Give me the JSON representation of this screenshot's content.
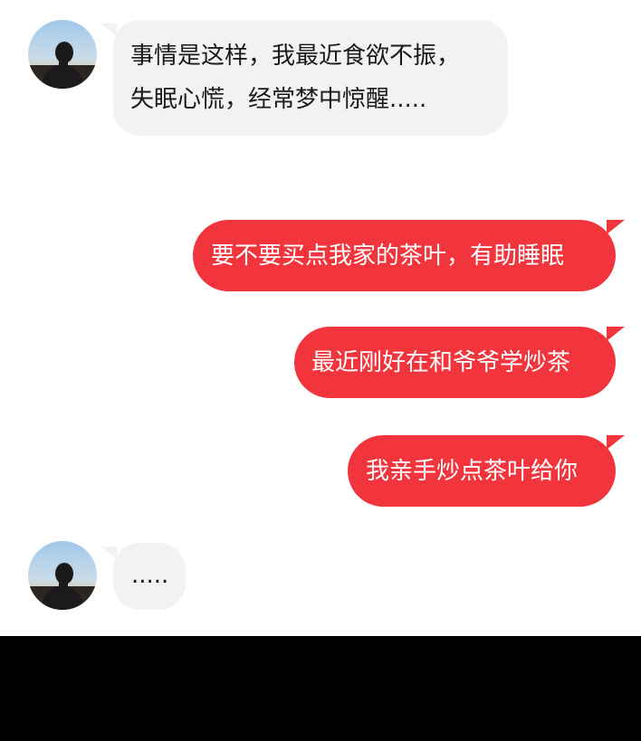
{
  "messages": [
    {
      "side": "incoming",
      "lines": [
        "事情是这样，我最近食欲不振，",
        "失眠心慌，经常梦中惊醒....."
      ]
    },
    {
      "side": "outgoing",
      "text": "要不要买点我家的茶叶，有助睡眠"
    },
    {
      "side": "outgoing",
      "text": "最近刚好在和爷爷学炒茶"
    },
    {
      "side": "outgoing",
      "text": "我亲手炒点茶叶给你"
    },
    {
      "side": "incoming",
      "text": "....."
    }
  ],
  "colors": {
    "outgoing_bubble": "#f2343c",
    "incoming_bubble": "#f2f2f2",
    "background": "#ffffff",
    "bottom_bar": "#000000"
  },
  "icons": {
    "avatar": "contact-avatar-man-in-dark-jacket"
  }
}
